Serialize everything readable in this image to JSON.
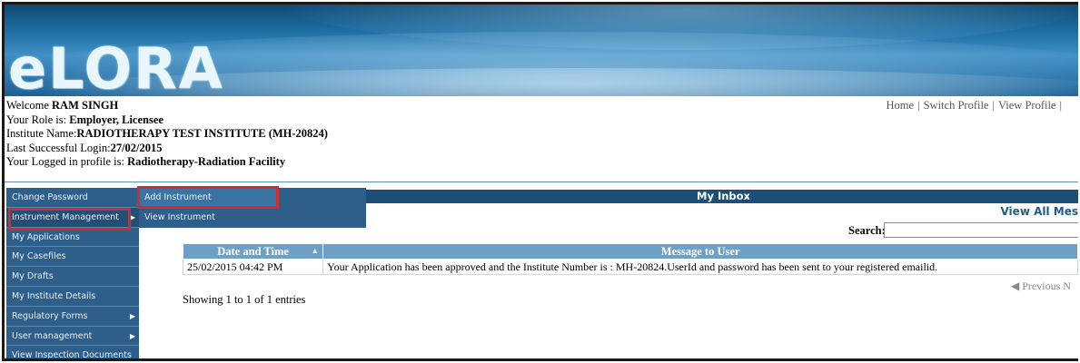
{
  "header": {
    "logo_text": "eLORA",
    "banner_colors": [
      "#0f4a74",
      "#3f8fc4"
    ]
  },
  "user_info": {
    "welcome_label": "Welcome ",
    "user_name": "RAM SINGH",
    "role_label": "Your Role is: ",
    "role_value": "Employer, Licensee",
    "institute_label": "Institute Name:",
    "institute_value": "RADIOTHERAPY TEST INSTITUTE (MH-20824)",
    "last_login_label": "Last Successful Login:",
    "last_login_value": "27/02/2015",
    "profile_label": "Your Logged in profile is: ",
    "profile_value": "Radiotherapy-Radiation Facility"
  },
  "top_links": {
    "home": "Home",
    "switch_profile": "Switch Profile",
    "view_profile": "View Profile",
    "separator": "|"
  },
  "sidebar": {
    "items": [
      {
        "label": "Change Password",
        "has_submenu": false
      },
      {
        "label": "Instrument Management",
        "has_submenu": true
      },
      {
        "label": "My Applications",
        "has_submenu": false
      },
      {
        "label": "My Casefiles",
        "has_submenu": false
      },
      {
        "label": "My Drafts",
        "has_submenu": false
      },
      {
        "label": "My Institute Details",
        "has_submenu": false
      },
      {
        "label": "Regulatory Forms",
        "has_submenu": true
      },
      {
        "label": "User management",
        "has_submenu": true
      },
      {
        "label": "View Inspection Documents",
        "has_submenu": false
      }
    ]
  },
  "submenu": {
    "items": [
      {
        "label": "Add Instrument"
      },
      {
        "label": "View Instrument"
      }
    ]
  },
  "inbox": {
    "title": "My Inbox",
    "view_all": "View All Mes",
    "search_label": "Search:",
    "search_value": "",
    "columns": {
      "date": "Date and Time",
      "message": "Message to User"
    },
    "rows": [
      {
        "date": "25/02/2015 04:42 PM",
        "message": "Your Application has been approved and the Institute Number is : MH-20824.UserId and password has been sent to your registered emailid."
      }
    ],
    "showing": "Showing 1 to 1 of 1 entries",
    "pager_previous": "Previous",
    "pager_next_initial": "N"
  },
  "highlight_color": "#d12b2b"
}
